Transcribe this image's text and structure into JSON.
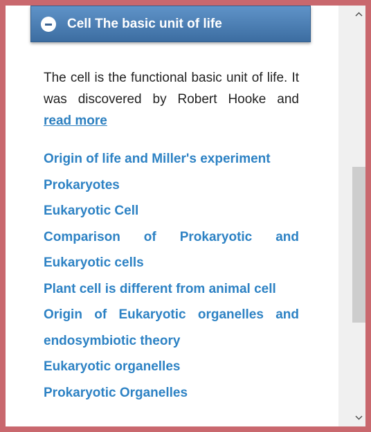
{
  "section": {
    "title": "Cell The basic unit of life",
    "icon": "minus-circle-icon",
    "header_color": "#4a7fb5"
  },
  "summary": {
    "text": "The cell is the functional basic unit of life. It was discovered by Robert Hooke and",
    "read_more": "read more"
  },
  "links": [
    {
      "label": "Origin of life and Miller's experiment"
    },
    {
      "label": "Prokaryotes"
    },
    {
      "label": "Eukaryotic Cell"
    },
    {
      "label": "Comparison of Prokaryotic and Eukaryotic cells"
    },
    {
      "label": "Plant cell is different from animal cell"
    },
    {
      "label": "Origin of Eukaryotic organelles and endosymbiotic theory"
    },
    {
      "label": "Eukaryotic organelles"
    },
    {
      "label": "Prokaryotic Organelles"
    }
  ],
  "colors": {
    "link": "#2d82c4",
    "window_border": "#c9686e"
  },
  "scrollbar": {
    "up_icon": "chevron-up-icon",
    "down_icon": "chevron-down-icon"
  }
}
